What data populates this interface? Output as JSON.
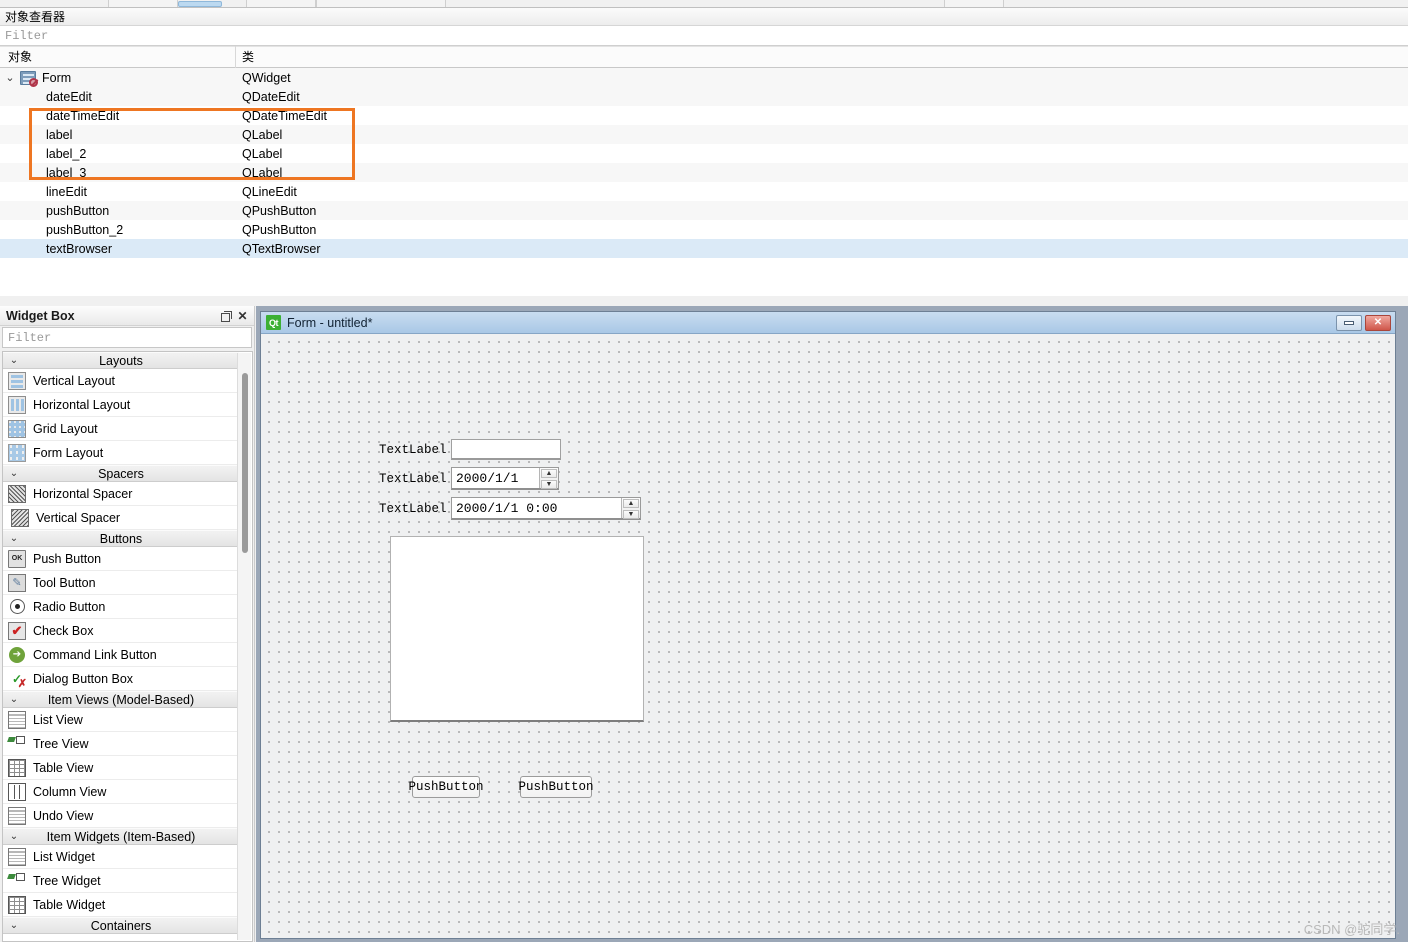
{
  "object_inspector": {
    "dock_title": "对象查看器",
    "filter_placeholder": "Filter",
    "columns": [
      "对象",
      "类"
    ],
    "root": {
      "name": "Form",
      "class": "QWidget",
      "icon": "form-widget-icon"
    },
    "rows": [
      {
        "name": "dateEdit",
        "class": "QDateEdit"
      },
      {
        "name": "dateTimeEdit",
        "class": "QDateTimeEdit"
      },
      {
        "name": "label",
        "class": "QLabel"
      },
      {
        "name": "label_2",
        "class": "QLabel"
      },
      {
        "name": "label_3",
        "class": "QLabel"
      },
      {
        "name": "lineEdit",
        "class": "QLineEdit"
      },
      {
        "name": "pushButton",
        "class": "QPushButton"
      },
      {
        "name": "pushButton_2",
        "class": "QPushButton"
      },
      {
        "name": "textBrowser",
        "class": "QTextBrowser"
      }
    ],
    "selected_row": "textBrowser",
    "highlight_color": "#ee7622",
    "selection_color": "#dbeaf7"
  },
  "widget_box": {
    "title": "Widget Box",
    "filter_placeholder": "Filter",
    "float_button": "float-icon",
    "close_button": "✕",
    "sections": [
      {
        "label": "Layouts",
        "items": [
          {
            "label": "Vertical Layout",
            "icon": "vertical-layout-icon"
          },
          {
            "label": "Horizontal Layout",
            "icon": "horizontal-layout-icon"
          },
          {
            "label": "Grid Layout",
            "icon": "grid-layout-icon"
          },
          {
            "label": "Form Layout",
            "icon": "form-layout-icon"
          }
        ]
      },
      {
        "label": "Spacers",
        "items": [
          {
            "label": "Horizontal Spacer",
            "icon": "horizontal-spacer-icon"
          },
          {
            "label": "Vertical Spacer",
            "icon": "vertical-spacer-icon"
          }
        ]
      },
      {
        "label": "Buttons",
        "items": [
          {
            "label": "Push Button",
            "icon": "push-button-icon"
          },
          {
            "label": "Tool Button",
            "icon": "tool-button-icon"
          },
          {
            "label": "Radio Button",
            "icon": "radio-button-icon"
          },
          {
            "label": "Check Box",
            "icon": "check-box-icon"
          },
          {
            "label": "Command Link Button",
            "icon": "command-link-icon"
          },
          {
            "label": "Dialog Button Box",
            "icon": "dialog-button-box-icon"
          }
        ]
      },
      {
        "label": "Item Views (Model-Based)",
        "items": [
          {
            "label": "List View",
            "icon": "list-view-icon"
          },
          {
            "label": "Tree View",
            "icon": "tree-view-icon"
          },
          {
            "label": "Table View",
            "icon": "table-view-icon"
          },
          {
            "label": "Column View",
            "icon": "column-view-icon"
          },
          {
            "label": "Undo View",
            "icon": "undo-view-icon"
          }
        ]
      },
      {
        "label": "Item Widgets (Item-Based)",
        "items": [
          {
            "label": "List Widget",
            "icon": "list-widget-icon"
          },
          {
            "label": "Tree Widget",
            "icon": "tree-widget-icon"
          },
          {
            "label": "Table Widget",
            "icon": "table-widget-icon"
          }
        ]
      },
      {
        "label": "Containers",
        "items": []
      }
    ]
  },
  "form_window": {
    "title": "Form - untitled*",
    "app_icon": "Qt",
    "minimize_button": "minimize-icon",
    "close_button": "✕",
    "widgets": {
      "label_1": "TextLabel",
      "label_2": "TextLabel",
      "label_3": "TextLabel",
      "line_edit_value": "",
      "date_edit_value": "2000/1/1",
      "date_time_edit_value": "2000/1/1 0:00",
      "text_browser_value": "",
      "push_button_1": "PushButton",
      "push_button_2": "PushButton",
      "spin_up": "▲",
      "spin_down": "▼"
    }
  },
  "watermark": "CSDN @驼同学."
}
